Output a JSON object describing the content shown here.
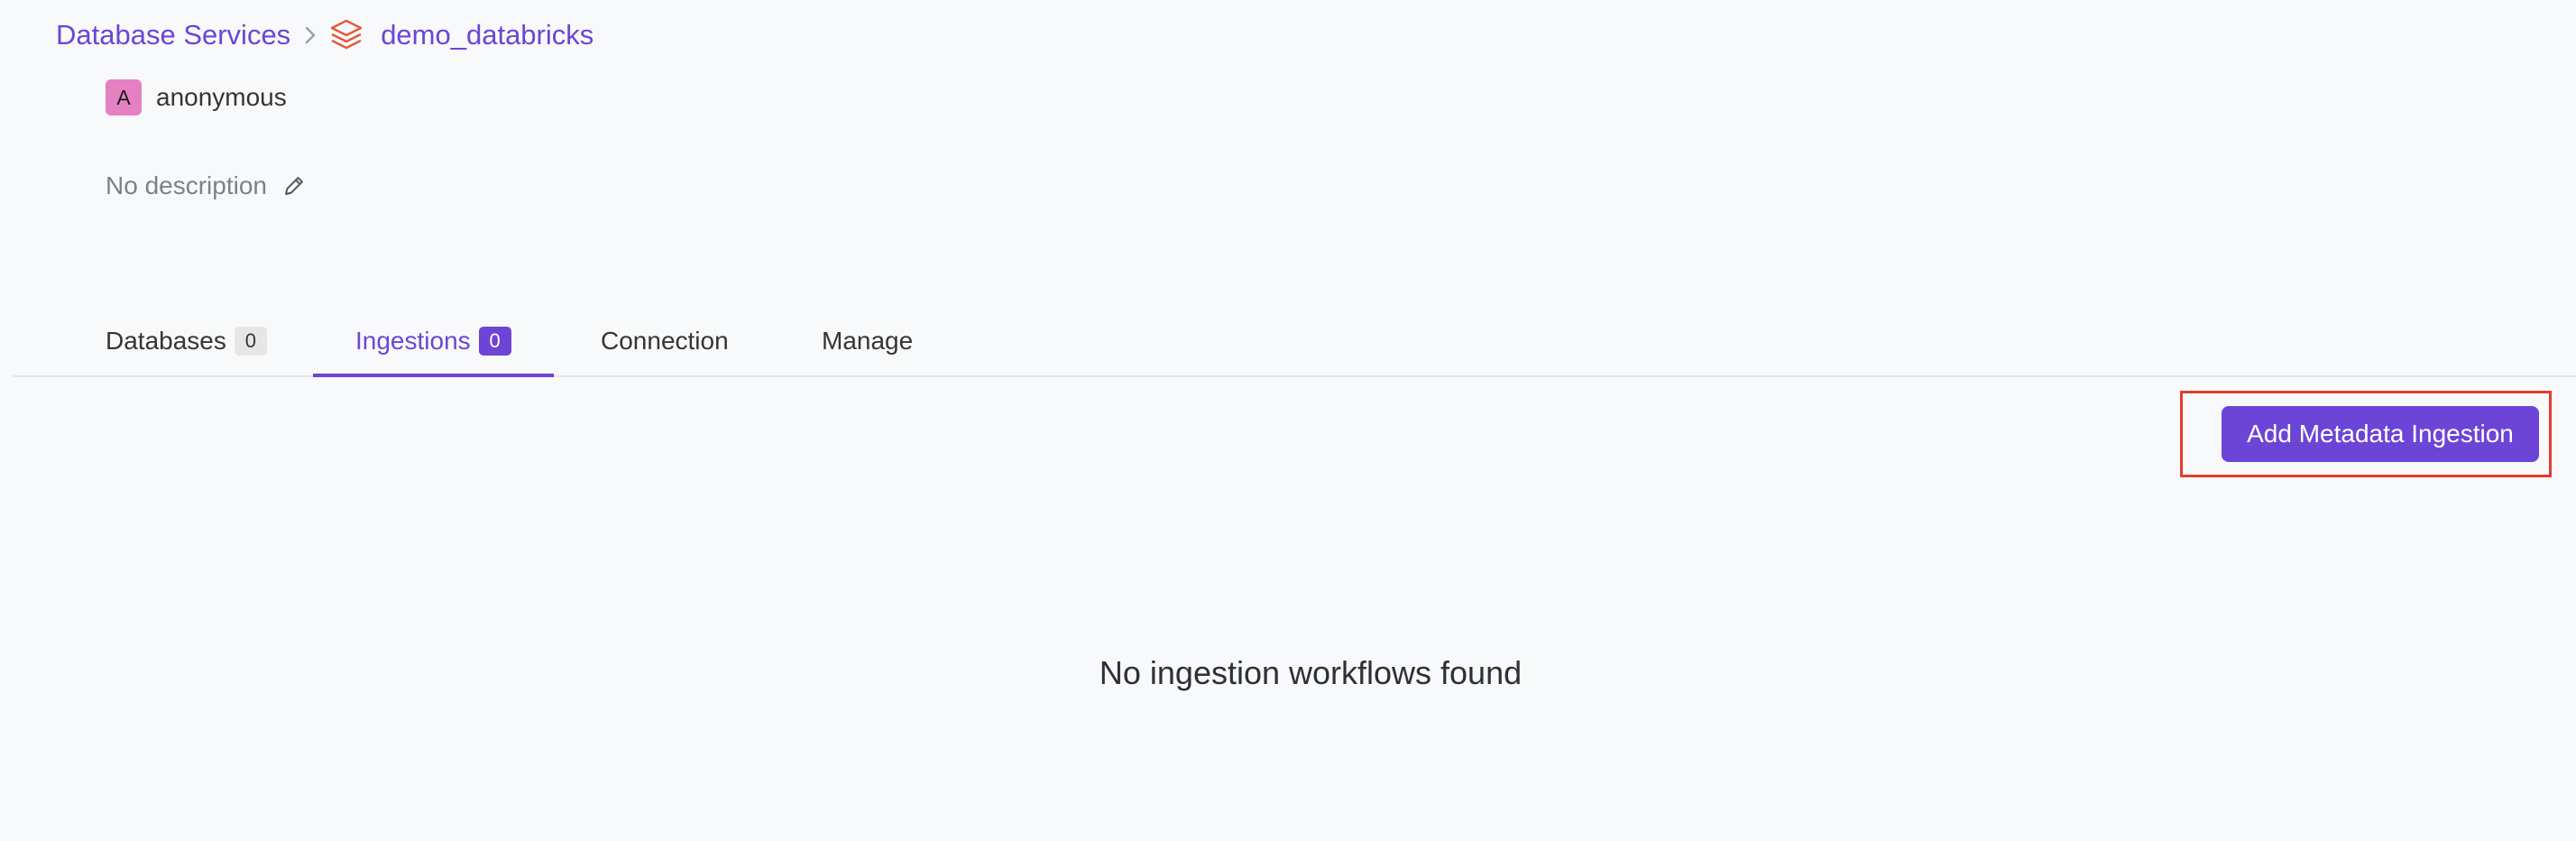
{
  "breadcrumb": {
    "parent": "Database Services",
    "separator": ">",
    "service_name": "demo_databricks",
    "service_icon": "databricks-stack-icon"
  },
  "owner": {
    "initial": "A",
    "name": "anonymous"
  },
  "description": {
    "text": "No description",
    "edit_icon": "pencil-icon"
  },
  "tabs": [
    {
      "label": "Databases",
      "count": "0",
      "active": false
    },
    {
      "label": "Ingestions",
      "count": "0",
      "active": true
    },
    {
      "label": "Connection",
      "active": false
    },
    {
      "label": "Manage",
      "active": false
    }
  ],
  "actions": {
    "add_label": "Add Metadata Ingestion"
  },
  "empty_state": {
    "message": "No ingestion workflows found"
  },
  "colors": {
    "accent": "#6c45d6",
    "highlight": "#e03f2e",
    "avatar": "#e580c3",
    "background": "#f8f9fb"
  }
}
